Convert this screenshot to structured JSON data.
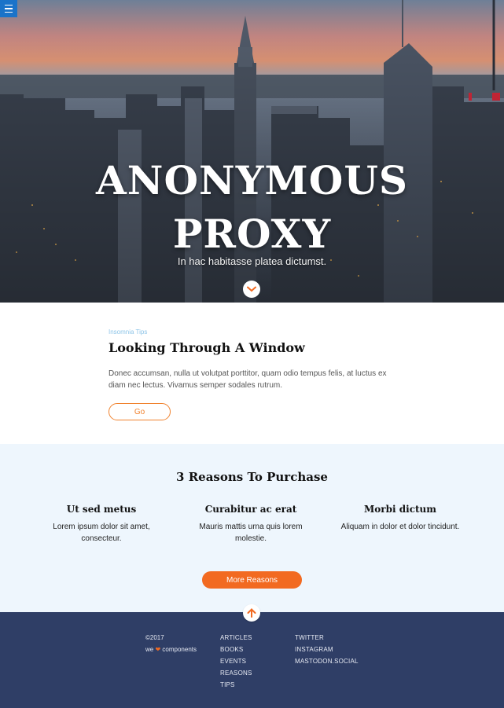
{
  "menu": {
    "icon": "hamburger-icon"
  },
  "hero": {
    "title_line1": "ANONYMOUS",
    "title_line2": "PROXY",
    "subtitle": "In hac habitasse platea dictumst.",
    "scroll_icon": "chevron-down-icon"
  },
  "article": {
    "tag": "Insomnia Tips",
    "title": "Looking Through A Window",
    "body": "Donec accumsan, nulla ut volutpat porttitor, quam odio tempus felis, at luctus ex diam nec lectus. Vivamus semper sodales rutrum.",
    "button": "Go"
  },
  "reasons": {
    "title": "3 Reasons To Purchase",
    "items": [
      {
        "heading": "Ut sed metus",
        "text": "Lorem ipsum dolor sit amet, consecteur."
      },
      {
        "heading": "Curabitur ac erat",
        "text": "Mauris mattis urna quis lorem molestie."
      },
      {
        "heading": "Morbi dictum",
        "text": "Aliquam in dolor et dolor tincidunt."
      }
    ],
    "button": "More Reasons"
  },
  "footer": {
    "up_icon": "arrow-up-icon",
    "copyright": "©2017",
    "tagline_we": "we",
    "tagline_heart": "❤",
    "tagline_rest": "components",
    "links_col1": [
      "ARTICLES",
      "BOOKS",
      "EVENTS",
      "REASONS",
      "TIPS"
    ],
    "links_col2": [
      "TWITTER",
      "INSTAGRAM",
      "MASTODON.SOCIAL"
    ]
  },
  "colors": {
    "accent_orange": "#f26a21",
    "footer_bg": "#2f3e66",
    "reasons_bg": "#eef6fd",
    "menu_blue": "#1a73c9"
  }
}
